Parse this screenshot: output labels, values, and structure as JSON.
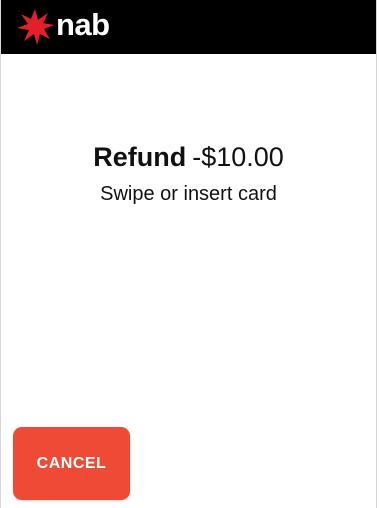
{
  "header": {
    "brand_text": "nab",
    "logo_icon": "nab-star-icon",
    "background_color": "#000000",
    "star_color": "#e3202a"
  },
  "transaction": {
    "type_label": "Refund",
    "amount": "-$10.00",
    "prompt": "Swipe or insert card"
  },
  "actions": {
    "cancel_label": "CANCEL",
    "cancel_color": "#ef4a36"
  }
}
